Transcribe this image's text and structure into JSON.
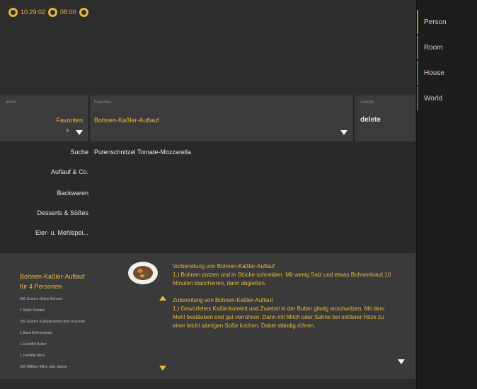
{
  "status": {
    "time1": "10:29:02",
    "time2": "08:00"
  },
  "nav": {
    "items": [
      {
        "label": "Person",
        "color": "#c8862a"
      },
      {
        "label": "Room",
        "color": "#3a8f5a"
      },
      {
        "label": "House",
        "color": "#2f7ea0"
      },
      {
        "label": "World",
        "color": "#6a4fa0"
      }
    ]
  },
  "filter": {
    "col1_label": "Index",
    "col1_value": "Favoriten",
    "col1_sub": "9",
    "col2_label": "Favorites",
    "col2_value": "Bohnen-Kaßler-Auflauf",
    "col3_label": "Actions",
    "col3_value": "delete"
  },
  "categories": [
    "Suche",
    "Auflauf & Co.",
    "Backwaren",
    "Desserts & Süßes",
    "Eier- u. Mehlspei..."
  ],
  "favorites": [
    "Putenschnitzel Tomate-Mozzarella"
  ],
  "recipe": {
    "title": "Bohnen-Kaßler-Auflauf",
    "servings": "für 4 Personen",
    "ingredients": [
      "500 Gramm Grüne Bohnen",
      "1 Stück Zwiebel",
      "250 Gramm Kaßlerkotelett ohne Knochen",
      "1 Bund Bohnenkraut",
      "1 Esslöffel Butter",
      "1 Teelöffel Mehl",
      "250 Milliliter Milch oder Sahne"
    ],
    "prep1_title": "Vorbereitung von Bohnen-Kaßler-Auflauf",
    "prep1_text": "1.) Bohnen putzen und in Stücke schneiden. Mit wenig Salz und etwas Bohnenkraut 10 Minuten blanchieren, dann abgießen.",
    "prep2_title": "Zubereitung von Bohnen-Kaßler-Auflauf",
    "prep2_text": "1.) Gewürfeltes Kaßlerkotelett und Zwiebel in der Butter glasig anschwitzen. Mit dem Mehl bestäuben und gut verrühren. Dann mit Milch oder Sahne bei mittlerer Hitze zu einer leicht sämigen Soße kochen. Dabei ständig rühren."
  }
}
